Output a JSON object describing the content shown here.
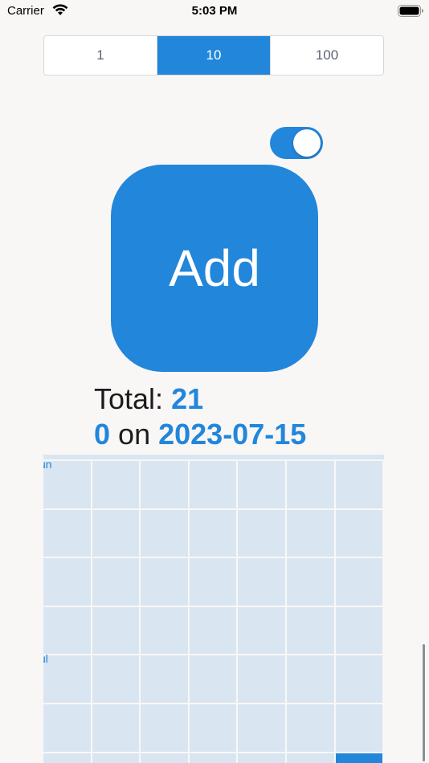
{
  "status_bar": {
    "carrier": "Carrier",
    "time": "5:03 PM"
  },
  "segments": [
    {
      "label": "1",
      "selected": false
    },
    {
      "label": "10",
      "selected": true
    },
    {
      "label": "100",
      "selected": false
    }
  ],
  "toggle": {
    "on": true
  },
  "add_button": {
    "label": "Add"
  },
  "total": {
    "label": "Total:",
    "value": "21"
  },
  "day_count": {
    "value": "0",
    "connector": "on",
    "date": "2023-07-15"
  },
  "heatmap": {
    "columns": 7,
    "rows": 7,
    "month_labels": [
      {
        "label": "Jun",
        "row": 0
      },
      {
        "label": "Jul",
        "row": 4
      }
    ],
    "filled_cells": [
      {
        "row": 6,
        "col": 6
      }
    ]
  },
  "colors": {
    "accent": "#2286db",
    "cell_empty": "#d9e6f1",
    "grid_line": "#f8f7f6",
    "background": "#f8f7f6"
  }
}
